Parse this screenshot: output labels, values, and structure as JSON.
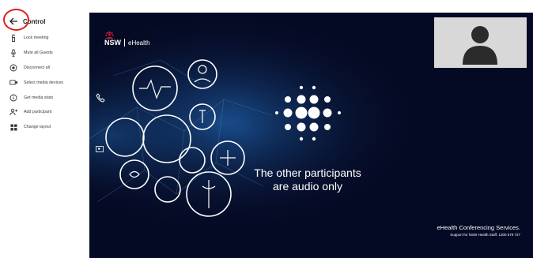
{
  "sidebar": {
    "title": "Control",
    "items": [
      {
        "label": "Lock meeting",
        "icon": "lock-icon"
      },
      {
        "label": "Mute all Guests",
        "icon": "microphone-icon"
      },
      {
        "label": "Disconnect all",
        "icon": "disconnect-icon"
      },
      {
        "label": "Select media devices",
        "icon": "camera-icon"
      },
      {
        "label": "Get media stats",
        "icon": "info-icon"
      },
      {
        "label": "Add participant",
        "icon": "add-person-icon"
      },
      {
        "label": "Change layout",
        "icon": "layout-grid-icon"
      }
    ]
  },
  "stage": {
    "brand_primary": "NSW",
    "brand_secondary": "eHealth",
    "audio_message_line1": "The other participants",
    "audio_message_line2": "are audio only",
    "footer_title": "eHealth Conferencing Services.",
    "footer_subtitle": "Support for NSW Health Staff: 1300 679 727"
  },
  "colors": {
    "stage_background": "#050a24",
    "highlight_ring": "#e11d1d",
    "self_view_background": "#d8d8d8",
    "nsw_waratah_red": "#d7153a"
  }
}
